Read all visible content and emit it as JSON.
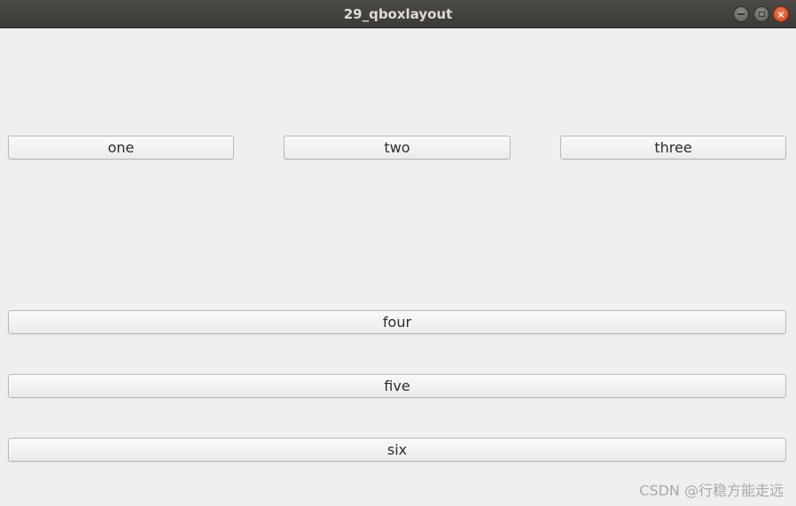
{
  "window": {
    "title": "29_qboxlayout",
    "controls": {
      "minimize_icon": "minimize-icon",
      "maximize_icon": "maximize-icon",
      "close_icon": "close-icon",
      "close_glyph": "×"
    }
  },
  "buttons": {
    "one": "one",
    "two": "two",
    "three": "three",
    "four": "four",
    "five": "five",
    "six": "six"
  },
  "watermark": "CSDN @行稳方能走远"
}
